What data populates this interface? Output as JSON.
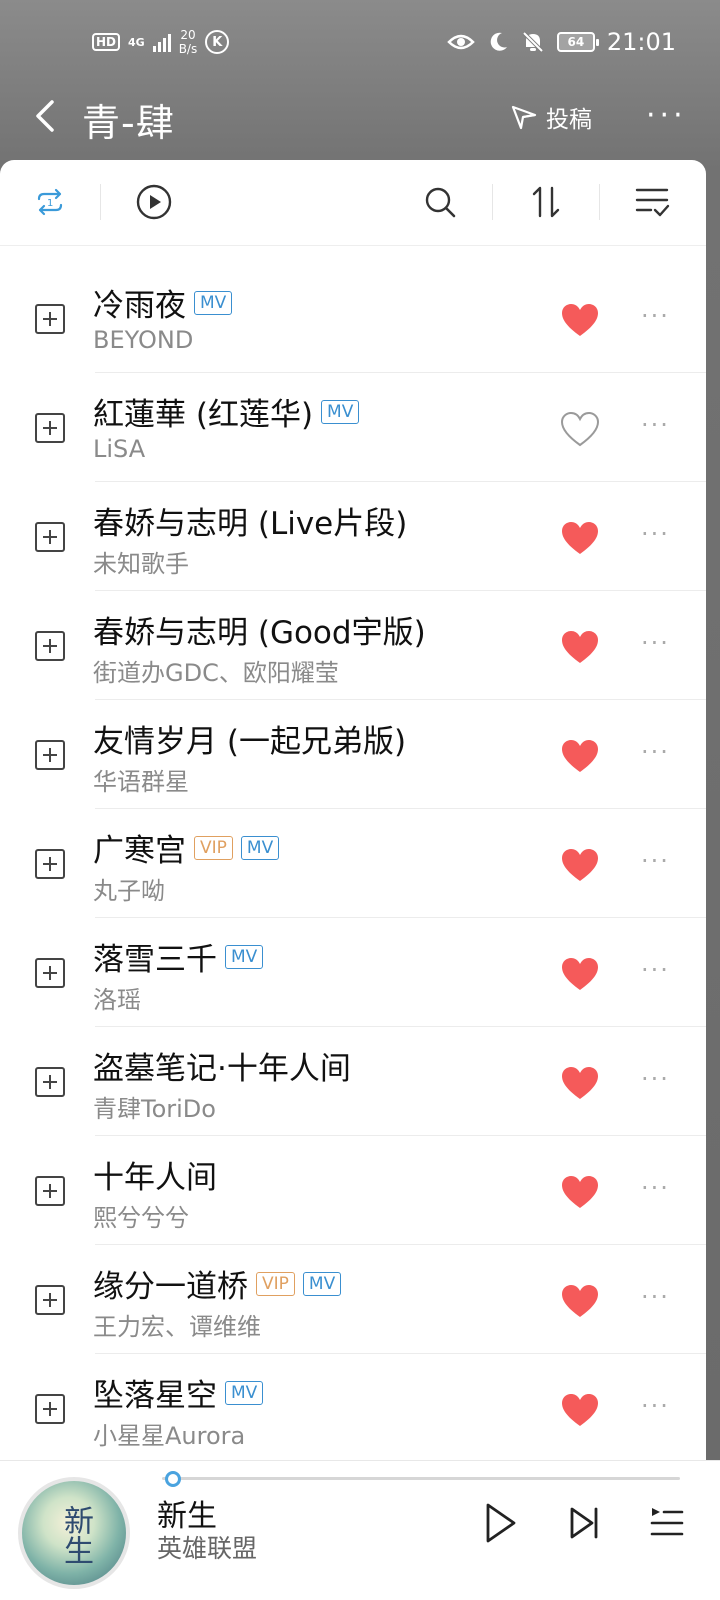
{
  "status_bar": {
    "hd": "HD",
    "network": "4G",
    "speed_value": "20",
    "speed_unit": "B/s",
    "k_icon": "K",
    "battery": "64",
    "time": "21:01",
    "icons": [
      "eye-icon",
      "moon-icon",
      "bell-off-icon",
      "battery-icon"
    ]
  },
  "header": {
    "title": "青-肆",
    "submit_label": "投稿",
    "more_label": "···"
  },
  "toolbar": {
    "icons": [
      "repeat-one-icon",
      "play-circle-icon",
      "search-icon",
      "sort-icon",
      "multi-select-icon"
    ]
  },
  "songs": [
    {
      "title": "冷雨夜",
      "artist": "BEYOND",
      "vip": false,
      "mv": true,
      "liked": true
    },
    {
      "title": "紅蓮華 (红莲华)",
      "artist": "LiSA",
      "vip": false,
      "mv": true,
      "liked": false
    },
    {
      "title": "春娇与志明 (Live片段)",
      "artist": "未知歌手",
      "vip": false,
      "mv": false,
      "liked": true
    },
    {
      "title": "春娇与志明 (Good宇版)",
      "artist": "街道办GDC、欧阳耀莹",
      "vip": false,
      "mv": false,
      "liked": true
    },
    {
      "title": "友情岁月 (一起兄弟版)",
      "artist": "华语群星",
      "vip": false,
      "mv": false,
      "liked": true
    },
    {
      "title": "广寒宫",
      "artist": "丸子呦",
      "vip": true,
      "mv": true,
      "liked": true
    },
    {
      "title": "落雪三千",
      "artist": "洛瑶",
      "vip": false,
      "mv": true,
      "liked": true
    },
    {
      "title": "盗墓笔记·十年人间",
      "artist": "青肆ToriDo",
      "vip": false,
      "mv": false,
      "liked": true
    },
    {
      "title": "十年人间",
      "artist": "熙兮兮兮",
      "vip": false,
      "mv": false,
      "liked": true
    },
    {
      "title": "缘分一道桥",
      "artist": "王力宏、谭维维",
      "vip": true,
      "mv": true,
      "liked": true
    },
    {
      "title": "坠落星空",
      "artist": "小星星Aurora",
      "vip": false,
      "mv": true,
      "liked": true
    }
  ],
  "badges": {
    "vip": "VIP",
    "mv": "MV"
  },
  "player": {
    "cover_text": "新生",
    "title": "新生",
    "artist": "英雄联盟",
    "progress": 0.01
  },
  "colors": {
    "heart_liked": "#f55a5a",
    "heart_unliked": "#9a9a9a",
    "mv_badge": "#3a8fd0",
    "vip_badge": "#e0a060",
    "accent": "#4aa3df"
  }
}
